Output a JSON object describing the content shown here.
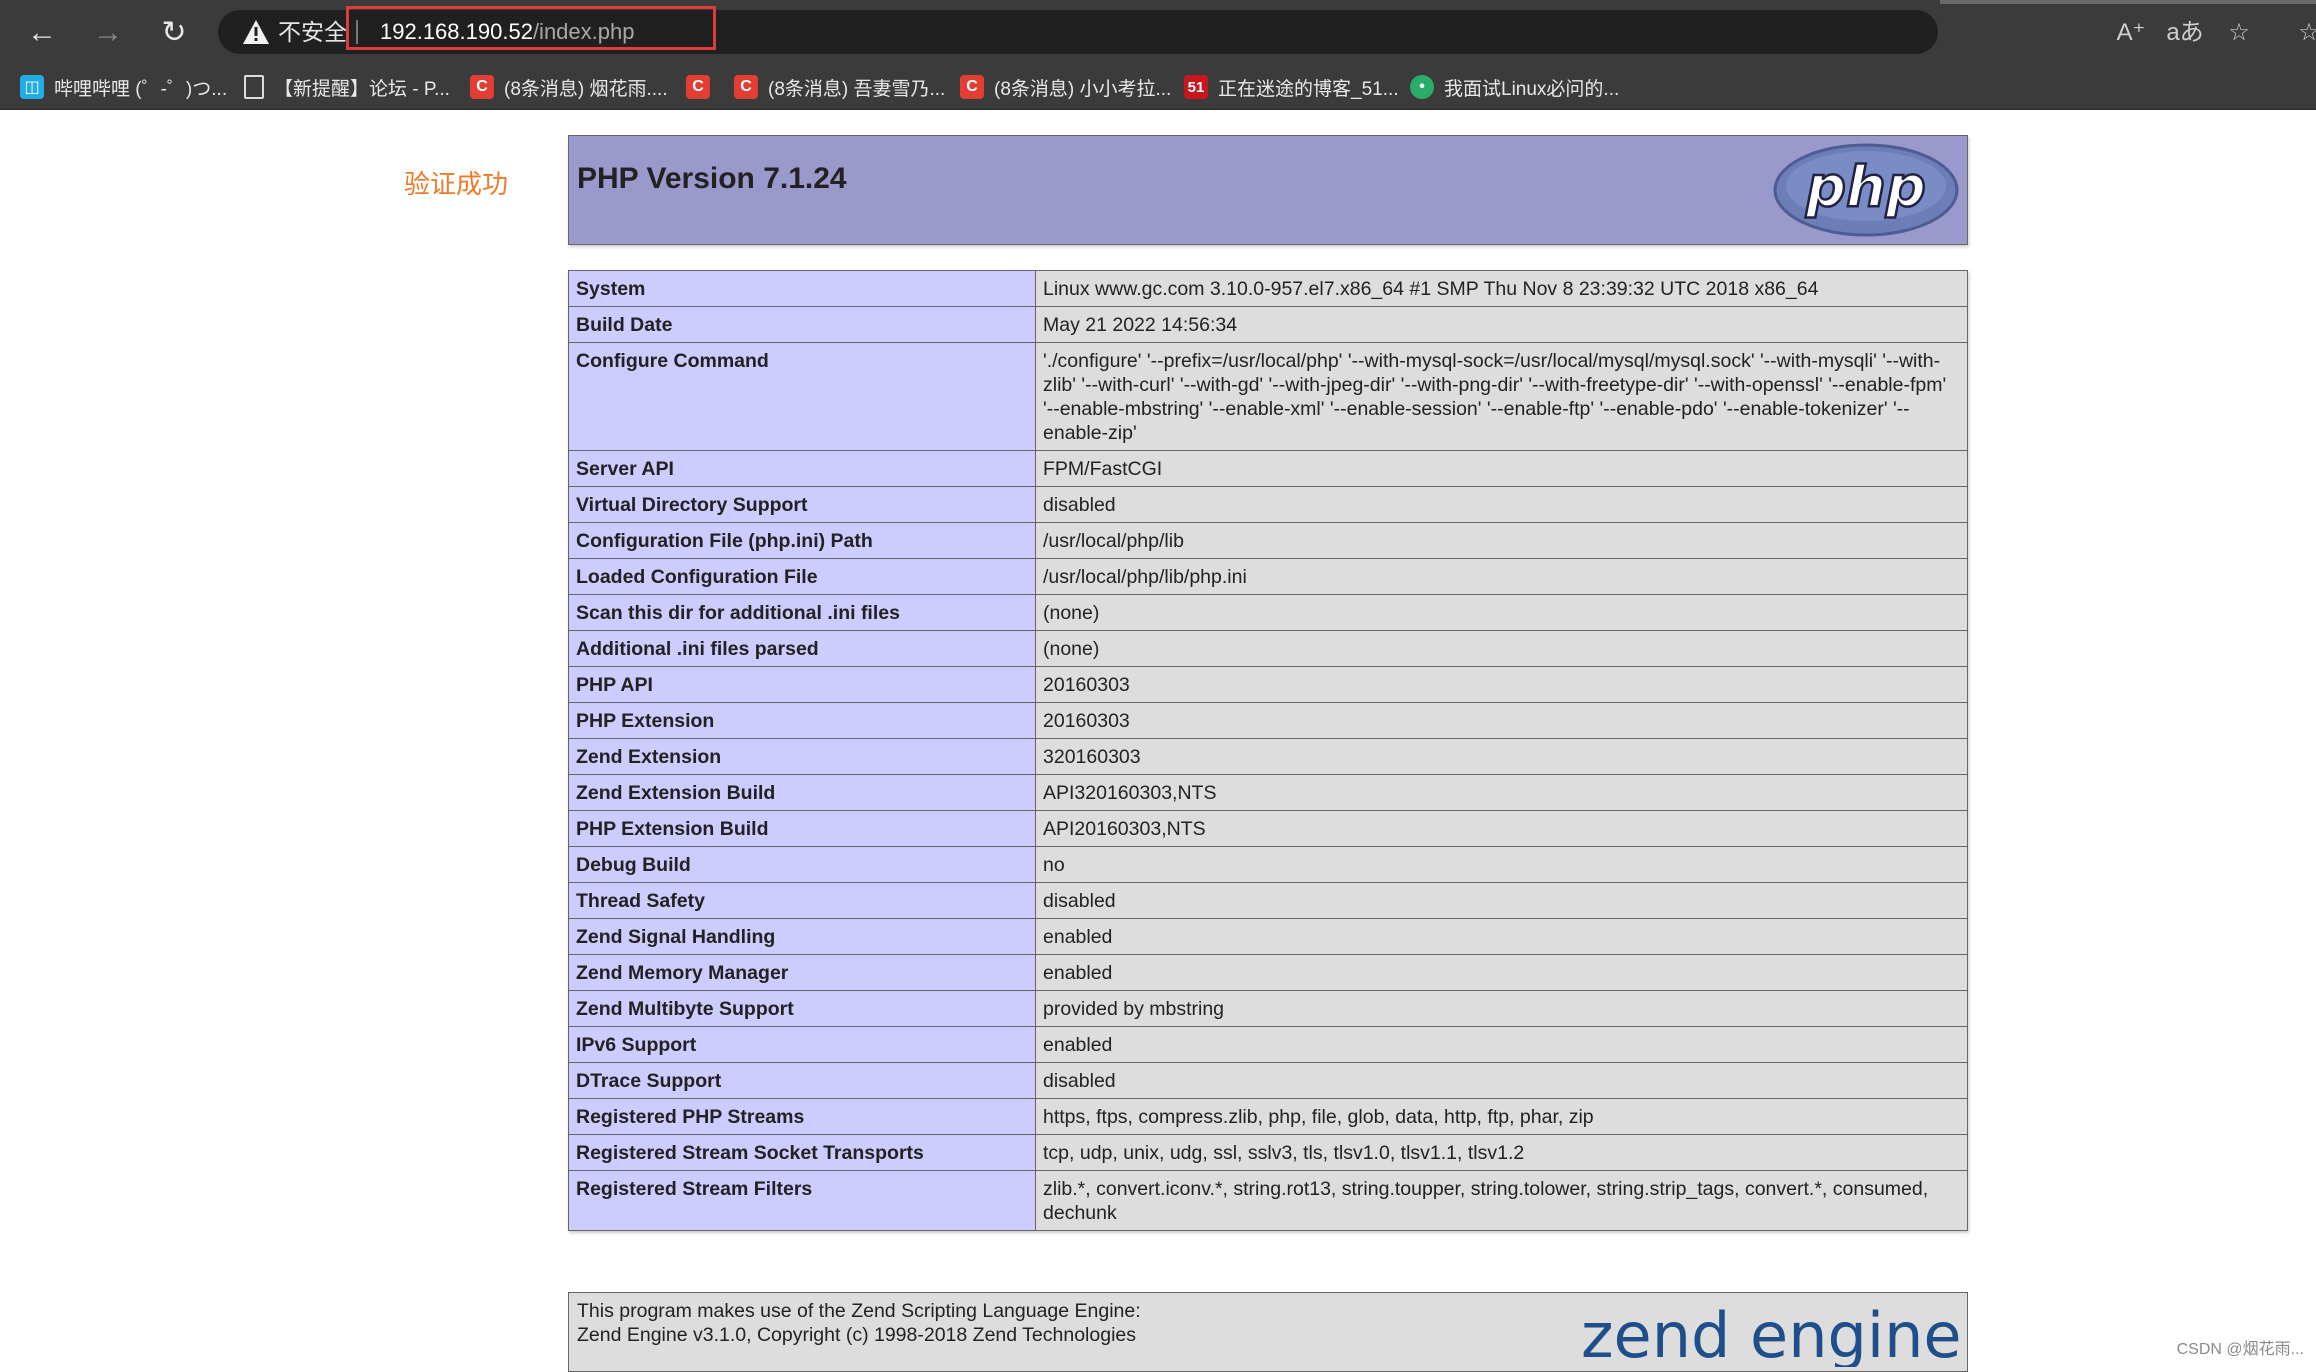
{
  "browser": {
    "insecure_label": "不安全",
    "url_host": "192.168.190.52",
    "url_path": "/index.php",
    "bookmarks": [
      {
        "label": "哔哩哔哩 (゜-゜)つ...",
        "icon": "bilibili-icon",
        "color": "#23ade5"
      },
      {
        "label": "【新提醒】论坛 - P...",
        "icon": "page-icon",
        "color": "#3b3b3b"
      },
      {
        "label": "(8条消息) 烟花雨....",
        "icon": "csdn-icon",
        "color": "#e33e33"
      },
      {
        "label": "",
        "icon": "csdn-icon",
        "color": "#e33e33"
      },
      {
        "label": "(8条消息) 吾妻雪乃...",
        "icon": "csdn-icon",
        "color": "#e33e33"
      },
      {
        "label": "(8条消息) 小小考拉...",
        "icon": "csdn-icon",
        "color": "#e33e33"
      },
      {
        "label": "正在迷途的博客_51...",
        "icon": "51cto-icon",
        "color": "#c9151e"
      },
      {
        "label": "我面试Linux必问的...",
        "icon": "wechat-icon",
        "color": "#2aae67"
      }
    ]
  },
  "page": {
    "success_text": "验证成功",
    "php_version": "PHP Version 7.1.24",
    "php_logo_text": "php",
    "rows": [
      {
        "k": "System",
        "v": "Linux www.gc.com 3.10.0-957.el7.x86_64 #1 SMP Thu Nov 8 23:39:32 UTC 2018 x86_64"
      },
      {
        "k": "Build Date",
        "v": "May 21 2022 14:56:34"
      },
      {
        "k": "Configure Command",
        "v": "'./configure' '--prefix=/usr/local/php' '--with-mysql-sock=/usr/local/mysql/mysql.sock' '--with-mysqli' '--with-zlib' '--with-curl' '--with-gd' '--with-jpeg-dir' '--with-png-dir' '--with-freetype-dir' '--with-openssl' '--enable-fpm' '--enable-mbstring' '--enable-xml' '--enable-session' '--enable-ftp' '--enable-pdo' '--enable-tokenizer' '--enable-zip'"
      },
      {
        "k": "Server API",
        "v": "FPM/FastCGI"
      },
      {
        "k": "Virtual Directory Support",
        "v": "disabled"
      },
      {
        "k": "Configuration File (php.ini) Path",
        "v": "/usr/local/php/lib"
      },
      {
        "k": "Loaded Configuration File",
        "v": "/usr/local/php/lib/php.ini"
      },
      {
        "k": "Scan this dir for additional .ini files",
        "v": "(none)"
      },
      {
        "k": "Additional .ini files parsed",
        "v": "(none)"
      },
      {
        "k": "PHP API",
        "v": "20160303"
      },
      {
        "k": "PHP Extension",
        "v": "20160303"
      },
      {
        "k": "Zend Extension",
        "v": "320160303"
      },
      {
        "k": "Zend Extension Build",
        "v": "API320160303,NTS"
      },
      {
        "k": "PHP Extension Build",
        "v": "API20160303,NTS"
      },
      {
        "k": "Debug Build",
        "v": "no"
      },
      {
        "k": "Thread Safety",
        "v": "disabled"
      },
      {
        "k": "Zend Signal Handling",
        "v": "enabled"
      },
      {
        "k": "Zend Memory Manager",
        "v": "enabled"
      },
      {
        "k": "Zend Multibyte Support",
        "v": "provided by mbstring"
      },
      {
        "k": "IPv6 Support",
        "v": "enabled"
      },
      {
        "k": "DTrace Support",
        "v": "disabled"
      },
      {
        "k": "Registered PHP Streams",
        "v": "https, ftps, compress.zlib, php, file, glob, data, http, ftp, phar, zip"
      },
      {
        "k": "Registered Stream Socket Transports",
        "v": "tcp, udp, unix, udg, ssl, sslv3, tls, tlsv1.0, tlsv1.1, tlsv1.2"
      },
      {
        "k": "Registered Stream Filters",
        "v": "zlib.*, convert.iconv.*, string.rot13, string.toupper, string.tolower, string.strip_tags, convert.*, consumed, dechunk"
      }
    ],
    "zend_line1": "This program makes use of the Zend Scripting Language Engine:",
    "zend_line2": "Zend Engine v3.1.0, Copyright (c) 1998-2018 Zend Technologies",
    "zend_logo_text": "zend engine",
    "watermark": "CSDN @烟花雨..."
  }
}
